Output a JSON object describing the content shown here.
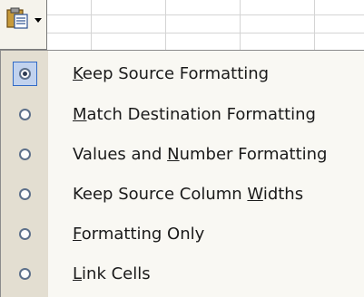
{
  "paste_options_button": {
    "icon": "paste-clipboard-icon",
    "arrow_icon": "dropdown-arrow-icon"
  },
  "menu": {
    "items": [
      {
        "label": "Keep Source Formatting",
        "selected": true,
        "accelerator": "K"
      },
      {
        "label": "Match Destination Formatting",
        "selected": false,
        "accelerator": "M"
      },
      {
        "label": "Values and Number Formatting",
        "selected": false,
        "accelerator": "N"
      },
      {
        "label": "Keep Source Column Widths",
        "selected": false,
        "accelerator": "W"
      },
      {
        "label": "Formatting Only",
        "selected": false,
        "accelerator": "F"
      },
      {
        "label": "Link Cells",
        "selected": false,
        "accelerator": "L"
      }
    ]
  },
  "colors": {
    "selection_fill": "#c1d2ee",
    "selection_border": "#316ac5",
    "menu_background": "#f9f8f3",
    "icon_strip": "#e3ded1"
  }
}
